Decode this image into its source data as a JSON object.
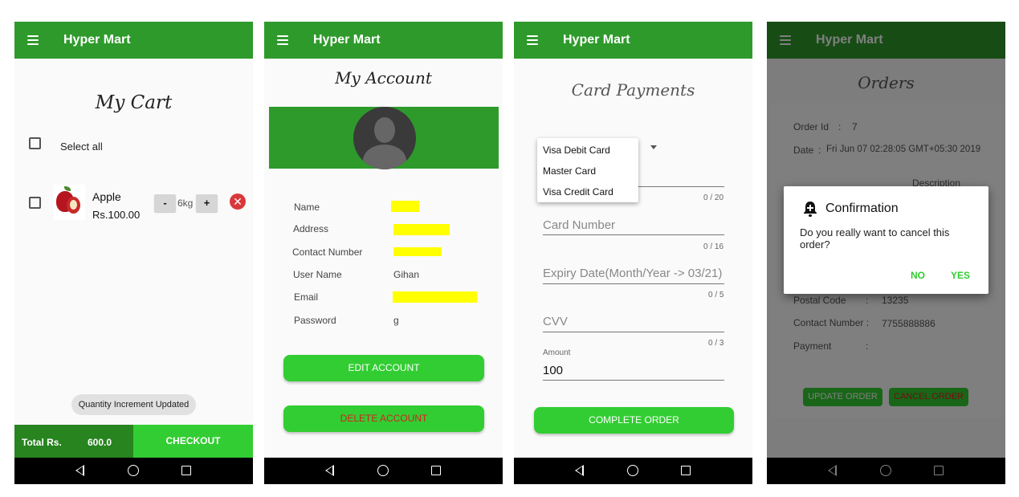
{
  "app_title": "Hyper Mart",
  "colors": {
    "primary": "#2e9a2b",
    "accent": "#32cd32",
    "danger": "#d9383a",
    "redaction": "#ffff00"
  },
  "cart": {
    "heading": "My Cart",
    "select_all": "Select all",
    "item": {
      "name": "Apple",
      "price": "Rs.100.00",
      "qty": "6kg",
      "minus": "-",
      "plus": "+",
      "remove_icon": "close-circle-icon"
    },
    "toast": "Quantity Increment Updated",
    "total_label": "Total Rs.",
    "total_value": "600.0",
    "checkout": "CHECKOUT"
  },
  "account": {
    "heading": "My Account",
    "fields": [
      {
        "label": "Name",
        "value": ""
      },
      {
        "label": "Address",
        "value": ""
      },
      {
        "label": "Contact Number",
        "value": ""
      },
      {
        "label": "User Name",
        "value": "Gihan"
      },
      {
        "label": "Email",
        "value": ""
      },
      {
        "label": "Password",
        "value": "g"
      }
    ],
    "edit_button": "EDIT ACCOUNT",
    "delete_button": "DELETE ACCOUNT"
  },
  "payments": {
    "heading": "Card Payments",
    "card_types": [
      "Visa Debit Card",
      "Master Card",
      "Visa Credit Card"
    ],
    "holder_counter": "0 / 20",
    "card_number_placeholder": "Card Number",
    "card_number_counter": "0 / 16",
    "expiry_placeholder": "Expiry Date(Month/Year -> 03/21)",
    "expiry_counter": "0 / 5",
    "cvv_placeholder": "CVV",
    "cvv_counter": "0 / 3",
    "amount_label": "Amount",
    "amount_value": "100",
    "complete_button": "COMPLETE ORDER"
  },
  "orders": {
    "heading": "Orders",
    "order_id_label": "Order Id",
    "order_id_value": "7",
    "date_label": "Date",
    "date_value": "Fri Jun 07 02:28:05 GMT+05:30 2019",
    "description_label": "Description",
    "postal_code_label": "Postal Code",
    "postal_code_value": "13235",
    "contact_label": "Contact Number :",
    "contact_value": "7755888886",
    "payment_label": "Payment",
    "update_button": "UPDATE ORDER",
    "cancel_button": "CANCEL ORDER",
    "dialog": {
      "title": "Confirmation",
      "message": "Do you really want to cancel this order?",
      "no": "NO",
      "yes": "YES"
    }
  }
}
